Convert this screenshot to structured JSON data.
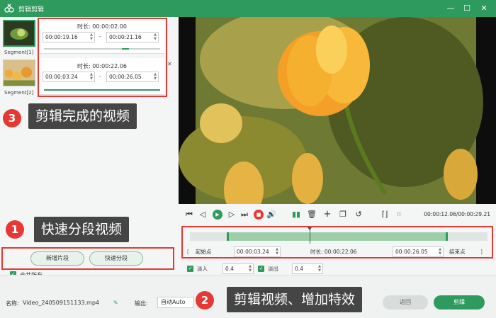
{
  "titlebar": {
    "title": "剪辑剪辑",
    "minimize": "—",
    "maximize": "☐",
    "close": "✕"
  },
  "segments": [
    {
      "label": "Segment[1]",
      "duration": "时长:  00:00:02.00",
      "start": "00:00:19.16",
      "end": "00:00:21.16"
    },
    {
      "label": "Segment[2]",
      "duration": "时长:  00:00:22.06",
      "start": "00:00:03.24",
      "end": "00:00:26.05"
    }
  ],
  "dash": "–",
  "close_x": "✕",
  "callouts": {
    "one": {
      "num": "1",
      "text": "快速分段视频"
    },
    "two": {
      "num": "2",
      "text": "剪辑视频、增加特效"
    },
    "three": {
      "num": "3",
      "text": "剪辑完成的视频"
    }
  },
  "left_actions": {
    "new_segment": "新增片段",
    "quick_split": "快速分段",
    "merge_all": "合并所有",
    "check": "✓"
  },
  "playback": {
    "timecode": "00:00:12.06/00:00:29.21"
  },
  "editor": {
    "start_btn": "起始点",
    "start_time": "00:00:03.24",
    "duration": "时长:  00:00:22.06",
    "end_time": "00:00:26.05",
    "end_btn": "结束点",
    "bracket_open": "[",
    "bracket_close": "]",
    "fade_in_label": "淡入",
    "fade_in_value": "0.4",
    "fade_out_label": "淡出",
    "fade_out_value": "0.4",
    "check": "✓"
  },
  "bottom": {
    "name_label": "名称:",
    "file_name": "Video_240509151133.mp4",
    "output_label": "输出:",
    "output_value": "自动Auto",
    "back_button": "返回",
    "cut_button": "剪辑"
  },
  "colors": {
    "accent": "#2f9a5e",
    "callout_red": "#e53935",
    "label_bg": "#454545"
  }
}
